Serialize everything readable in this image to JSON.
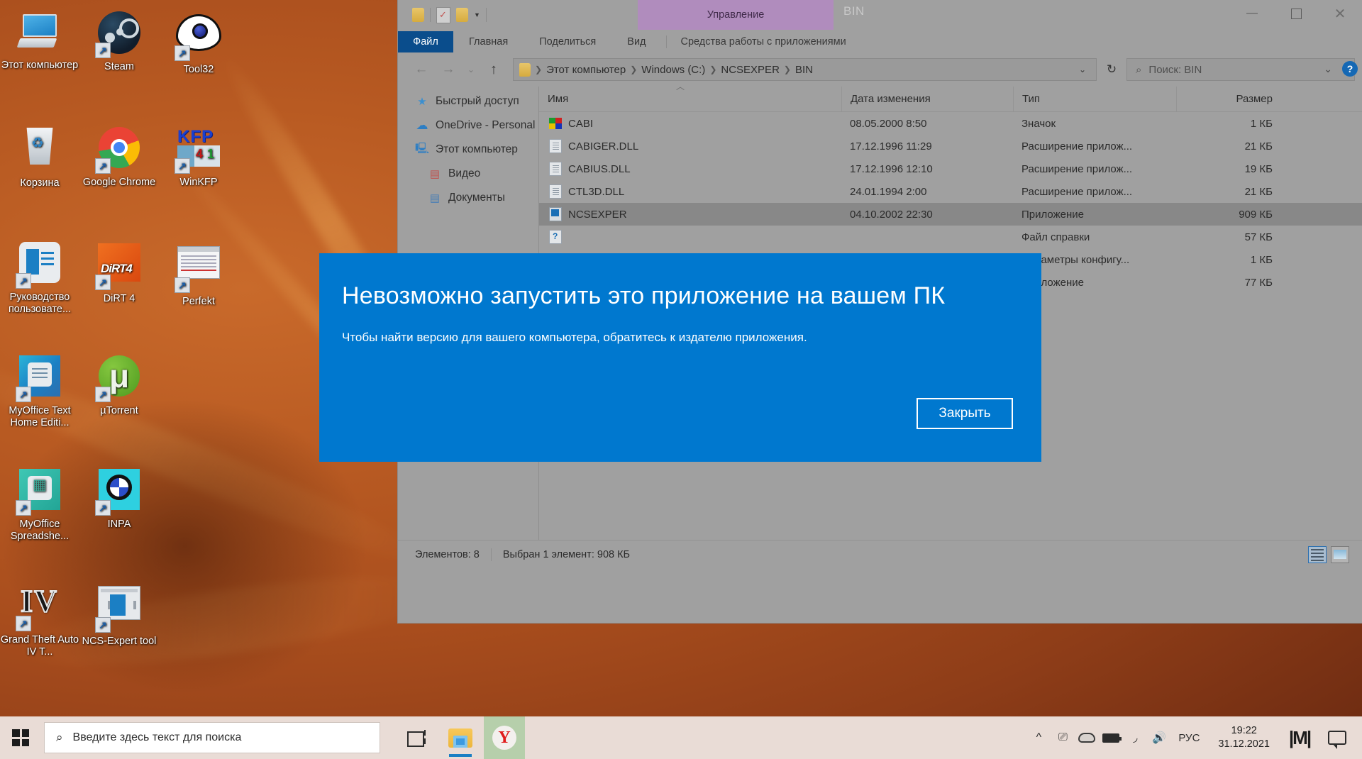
{
  "desktop": {
    "icons": [
      {
        "label": "Этот компьютер",
        "icon": "this-pc-icon",
        "shortcut": false
      },
      {
        "label": "Steam",
        "icon": "steam-icon",
        "shortcut": true
      },
      {
        "label": "Tool32",
        "icon": "tool32-eye-icon",
        "shortcut": true
      },
      {
        "label": "Корзина",
        "icon": "recycle-bin-icon",
        "shortcut": false
      },
      {
        "label": "Google Chrome",
        "icon": "google-chrome-icon",
        "shortcut": true
      },
      {
        "label": "WinKFP",
        "icon": "winkfp-icon",
        "shortcut": true
      },
      {
        "label": "Руководство пользовате...",
        "icon": "user-manual-icon",
        "shortcut": true
      },
      {
        "label": "DiRT 4",
        "icon": "dirt4-icon",
        "shortcut": true
      },
      {
        "label": "Perfekt",
        "icon": "perfekt-icon",
        "shortcut": true
      },
      {
        "label": "MyOffice Text Home Editi...",
        "icon": "myoffice-text-icon",
        "shortcut": true
      },
      {
        "label": "µTorrent",
        "icon": "utorrent-icon",
        "shortcut": true
      },
      {
        "label": "MyOffice Spreadshe...",
        "icon": "myoffice-spreadsheet-icon",
        "shortcut": true
      },
      {
        "label": "INPA",
        "icon": "inpa-bmw-icon",
        "shortcut": true
      },
      {
        "label": "Grand Theft Auto IV T...",
        "icon": "gta-iv-icon",
        "shortcut": true
      },
      {
        "label": "NCS-Expert tool",
        "icon": "ncs-expert-tool-icon",
        "shortcut": true
      }
    ]
  },
  "explorer": {
    "window_title": "BIN",
    "contextual_tab_group": "Управление",
    "contextual_tab_subtitle": "Средства работы с приложениями",
    "tabs": [
      {
        "label": "Файл",
        "active_file_tab": true
      },
      {
        "label": "Главная",
        "active_file_tab": false
      },
      {
        "label": "Поделиться",
        "active_file_tab": false
      },
      {
        "label": "Вид",
        "active_file_tab": false
      }
    ],
    "window_controls": {
      "minimize": "—",
      "maximize": "▢",
      "close": "✕",
      "collapse_ribbon": "⌄",
      "help": "?"
    },
    "breadcrumb": [
      "Этот компьютер",
      "Windows (C:)",
      "NCSEXPER",
      "BIN"
    ],
    "search_placeholder": "Поиск: BIN",
    "nav_back": "←",
    "nav_forward": "→",
    "nav_recent": "⌄",
    "nav_up": "↑",
    "refresh": "↻",
    "nav_pane": [
      {
        "label": "Быстрый доступ",
        "icon": "star-icon",
        "indent": false
      },
      {
        "label": "OneDrive - Personal",
        "icon": "onedrive-cloud-icon",
        "indent": false
      },
      {
        "label": "Этот компьютер",
        "icon": "this-pc-icon",
        "indent": false
      },
      {
        "label": "Видео",
        "icon": "videos-folder-icon",
        "indent": true
      },
      {
        "label": "Документы",
        "icon": "documents-folder-icon",
        "indent": true
      }
    ],
    "columns": [
      "Имя",
      "Дата изменения",
      "Тип",
      "Размер"
    ],
    "files": [
      {
        "name": "CABI",
        "date": "08.05.2000 8:50",
        "type": "Значок",
        "size": "1 КБ",
        "icon": "cab",
        "selected": false
      },
      {
        "name": "CABIGER.DLL",
        "date": "17.12.1996 11:29",
        "type": "Расширение прилож...",
        "size": "21 КБ",
        "icon": "dll",
        "selected": false
      },
      {
        "name": "CABIUS.DLL",
        "date": "17.12.1996 12:10",
        "type": "Расширение прилож...",
        "size": "19 КБ",
        "icon": "dll",
        "selected": false
      },
      {
        "name": "CTL3D.DLL",
        "date": "24.01.1994 2:00",
        "type": "Расширение прилож...",
        "size": "21 КБ",
        "icon": "dll",
        "selected": false
      },
      {
        "name": "NCSEXPER",
        "date": "04.10.2002 22:30",
        "type": "Приложение",
        "size": "909 КБ",
        "icon": "exe",
        "selected": true
      },
      {
        "name": "",
        "date": "",
        "type": "Файл справки",
        "size": "57 КБ",
        "icon": "hlp",
        "selected": false
      },
      {
        "name": "",
        "date": "",
        "type": "Параметры конфигу...",
        "size": "1 КБ",
        "icon": "cfg",
        "selected": false
      },
      {
        "name": "",
        "date": "",
        "type": "Приложение",
        "size": "77 КБ",
        "icon": "exe",
        "selected": false
      }
    ],
    "status": {
      "items_count": "Элементов: 8",
      "selection": "Выбран 1 элемент: 908 КБ"
    },
    "view_buttons": {
      "details": "details-view-icon",
      "large_icons": "large-icons-view-icon"
    }
  },
  "dialog": {
    "title": "Невозможно запустить это приложение на вашем ПК",
    "body": "Чтобы найти версию для вашего компьютера, обратитесь к издателю приложения.",
    "close_label": "Закрыть",
    "accent": "#0078cf"
  },
  "taskbar": {
    "start": "start-button",
    "search_placeholder": "Введите здесь текст для поиска",
    "buttons": [
      {
        "name": "task-view-button",
        "icon": "task-view-icon"
      },
      {
        "name": "file-explorer-button",
        "icon": "file-explorer-icon"
      },
      {
        "name": "yandex-browser-button",
        "icon": "yandex-icon"
      }
    ],
    "tray": {
      "overflow": "^",
      "icons": [
        "projector-icon",
        "onedrive-cloud-icon",
        "battery-icon",
        "wifi-icon",
        "volume-icon"
      ],
      "language": "РУС",
      "time": "19:22",
      "date": "31.12.2021",
      "app_icon": "msi-afterburner-icon",
      "action_center": "action-center-icon"
    }
  }
}
